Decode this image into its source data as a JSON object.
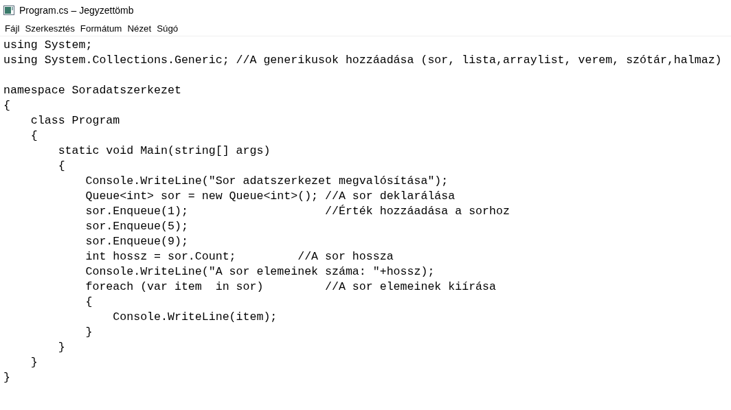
{
  "window": {
    "title": "Program.cs – Jegyzettömb"
  },
  "menu": [
    "Fájl",
    "Szerkesztés",
    "Formátum",
    "Nézet",
    "Súgó"
  ],
  "editor": {
    "content": "using System;\nusing System.Collections.Generic; //A generikusok hozzáadása (sor, lista,arraylist, verem, szótár,halmaz)\n\nnamespace Soradatszerkezet\n{\n    class Program\n    {\n        static void Main(string[] args)\n        {\n            Console.WriteLine(\"Sor adatszerkezet megvalósítása\");\n            Queue<int> sor = new Queue<int>(); //A sor deklarálása\n            sor.Enqueue(1);                    //Érték hozzáadása a sorhoz\n            sor.Enqueue(5);\n            sor.Enqueue(9);\n            int hossz = sor.Count;         //A sor hossza\n            Console.WriteLine(\"A sor elemeinek száma: \"+hossz);\n            foreach (var item  in sor)         //A sor elemeinek kiírása\n            {\n                Console.WriteLine(item);\n            }\n        }\n    }\n}"
  }
}
